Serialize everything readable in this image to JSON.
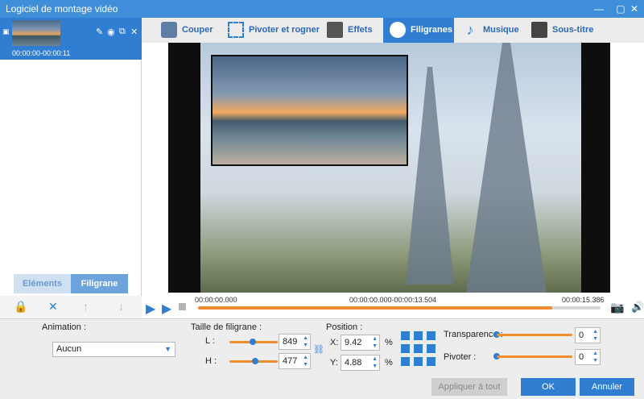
{
  "window": {
    "title": "Logiciel de montage vidéo",
    "minimize_icon": "minimize-icon",
    "close_icon": "close-icon"
  },
  "clip": {
    "time": "00:00:00-00:00:11",
    "edit_icon": "pencil-icon",
    "view_icon": "eye-icon",
    "copy_icon": "copy-icon",
    "delete_icon": "close-icon"
  },
  "left_tabs": {
    "elements": "Eléments",
    "watermark": "Filigrane"
  },
  "toolbar": {
    "tabs": [
      {
        "label": "Couper",
        "icon": "scissors-icon"
      },
      {
        "label": "Pivoter et rogner",
        "icon": "crop-icon"
      },
      {
        "label": "Effets",
        "icon": "effects-icon"
      },
      {
        "label": "Filigranes",
        "icon": "film-reel-icon"
      },
      {
        "label": "Musique",
        "icon": "music-note-icon"
      },
      {
        "label": "Sous-titre",
        "icon": "subtitle-icon"
      }
    ],
    "active": "Filigranes"
  },
  "player": {
    "time_start": "00:00:00.000",
    "time_range": "00:00:00.000-00:00:13.504",
    "time_end": "00:00:15.386",
    "progress": 0.88
  },
  "settings": {
    "animation_label": "Animation :",
    "animation_value": "Aucun",
    "size_label": "Taille de filigrane :",
    "width_label": "L :",
    "width_value": "849",
    "height_label": "H :",
    "height_value": "477",
    "position_label": "Position :",
    "x_label": "X:",
    "x_value": "9.42",
    "y_label": "Y:",
    "y_value": "4.88",
    "percent": "%",
    "transparency_label": "Transparence :",
    "transparency_value": "0",
    "rotate_label": "Pivoter :",
    "rotate_value": "0"
  },
  "buttons": {
    "apply_all": "Appliquer à tout",
    "ok": "OK",
    "cancel": "Annuler"
  },
  "colors": {
    "accent": "#2f7ed2",
    "slider": "#f08c2d",
    "titlebar": "#3f8ed9"
  }
}
